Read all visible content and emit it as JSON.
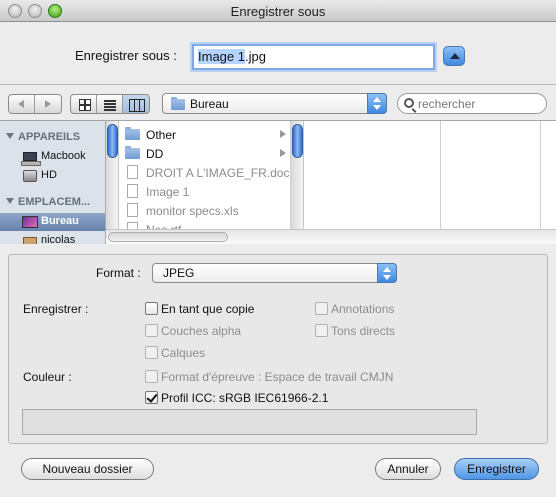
{
  "window": {
    "title": "Enregistrer sous"
  },
  "save_as": {
    "label": "Enregistrer sous :",
    "filename_selected": "Image 1",
    "filename_ext": ".jpg"
  },
  "toolbar": {
    "location": "Bureau",
    "search_placeholder": "rechercher"
  },
  "sidebar": {
    "sections": [
      {
        "title": "APPAREILS",
        "items": [
          {
            "label": "Macbook",
            "icon": "laptop-icon"
          },
          {
            "label": "HD",
            "icon": "hard-drive-icon"
          }
        ]
      },
      {
        "title": "EMPLACEM...",
        "items": [
          {
            "label": "Bureau",
            "icon": "desktop-icon",
            "selected": true
          },
          {
            "label": "nicolas",
            "icon": "home-icon"
          }
        ]
      }
    ]
  },
  "files": [
    {
      "name": "Other",
      "kind": "folder",
      "enabled": true
    },
    {
      "name": "DD",
      "kind": "folder",
      "enabled": true
    },
    {
      "name": "DROIT A L'IMAGE_FR.doc",
      "kind": "document",
      "enabled": false
    },
    {
      "name": "Image 1",
      "kind": "document",
      "enabled": false
    },
    {
      "name": "monitor specs.xls",
      "kind": "document",
      "enabled": false
    },
    {
      "name": "Nos.rtf",
      "kind": "document",
      "enabled": false
    }
  ],
  "options": {
    "format_label": "Format :",
    "format_value": "JPEG",
    "save_label": "Enregistrer :",
    "checks": {
      "copy": {
        "label": "En tant que copie",
        "checked": false,
        "enabled": true
      },
      "annotations": {
        "label": "Annotations",
        "checked": false,
        "enabled": false
      },
      "alpha": {
        "label": "Couches alpha",
        "checked": false,
        "enabled": false
      },
      "spot": {
        "label": "Tons directs",
        "checked": false,
        "enabled": false
      },
      "layers": {
        "label": "Calques",
        "checked": false,
        "enabled": false
      }
    },
    "color_label": "Couleur :",
    "proof": {
      "label": "Format d'épreuve : Espace de travail CMJN",
      "checked": false,
      "enabled": false
    },
    "icc": {
      "label": "Profil ICC:  sRGB IEC61966-2.1",
      "checked": true,
      "enabled": true
    }
  },
  "buttons": {
    "new_folder": "Nouveau dossier",
    "cancel": "Annuler",
    "save": "Enregistrer"
  },
  "colors": {
    "accent": "#4f96e6",
    "sidebar_bg": "#dbe2ea",
    "selection": "#6783ac"
  }
}
